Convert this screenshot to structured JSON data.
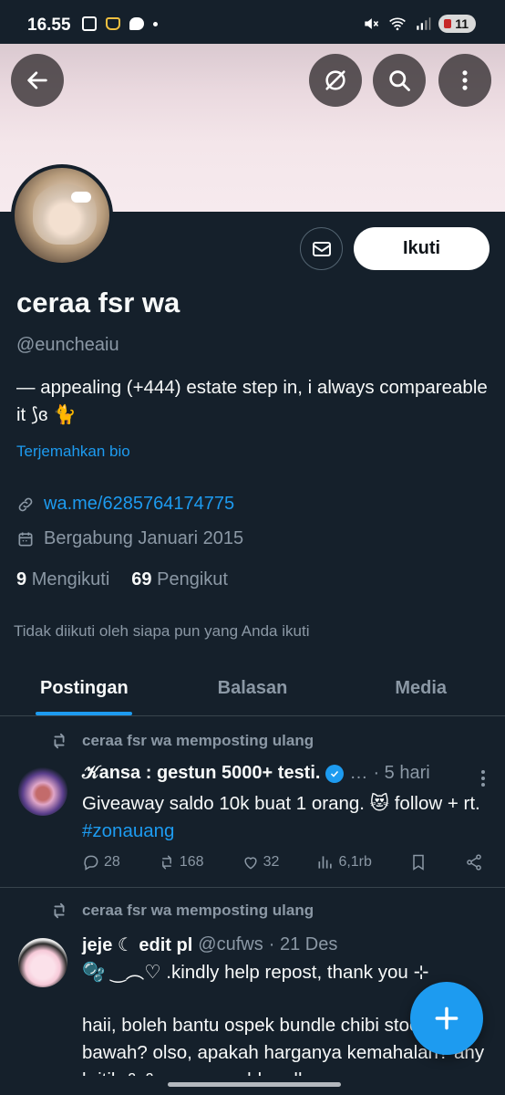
{
  "status_bar": {
    "time": "16.55",
    "battery": "11"
  },
  "profile": {
    "display_name": "ceraa fsr wa",
    "handle": "@euncheaiu",
    "bio": "— appealing (+444) estate step in, i always compareable it ⟆ɞ 🐈",
    "translate_label": "Terjemahkan bio",
    "link": "wa.me/6285764174775",
    "joined": "Bergabung Januari 2015",
    "following_count": "9",
    "following_label": "Mengikuti",
    "followers_count": "69",
    "followers_label": "Pengikut",
    "not_followed_text": "Tidak diikuti oleh siapa pun yang Anda ikuti",
    "follow_button": "Ikuti"
  },
  "tabs": [
    {
      "label": "Postingan",
      "active": true
    },
    {
      "label": "Balasan",
      "active": false
    },
    {
      "label": "Media",
      "active": false
    }
  ],
  "posts": [
    {
      "repost_label": "ceraa fsr wa memposting ulang",
      "author_name": "𝒦ansa : gestun 5000+ testi.",
      "verified": true,
      "ellipsis": "…",
      "time": "· 5 hari",
      "text": "Giveaway saldo 10k buat 1 orang. 😻 follow + rt.",
      "hashtag": "#zonauang",
      "stats": {
        "replies": "28",
        "reposts": "168",
        "likes": "32",
        "views": "6,1rb"
      }
    },
    {
      "repost_label": "ceraa fsr wa memposting ulang",
      "author_name": "jeje ☾ edit pl",
      "author_handle": "@cufws",
      "time": "· 21 Des",
      "text_line1": "🫧 ‿︵♡ .kindly help repost, thank you ⊹",
      "text_line2": "haii, boleh bantu ospek bundle chibi stock di bawah? olso, apakah harganya kemahalan? any kritik & & saran would really"
    }
  ],
  "icons": {
    "back": "arrow-left-icon",
    "grok": "no-circle-icon",
    "search": "search-icon",
    "more": "more-vertical-icon",
    "message": "envelope-icon",
    "link": "link-icon",
    "calendar": "calendar-icon",
    "repost": "repost-icon",
    "compose": "plus-icon"
  },
  "colors": {
    "background": "#15202b",
    "accent": "#1d9bf0",
    "muted": "#8b98a5",
    "banner": "#f4e6ea"
  }
}
